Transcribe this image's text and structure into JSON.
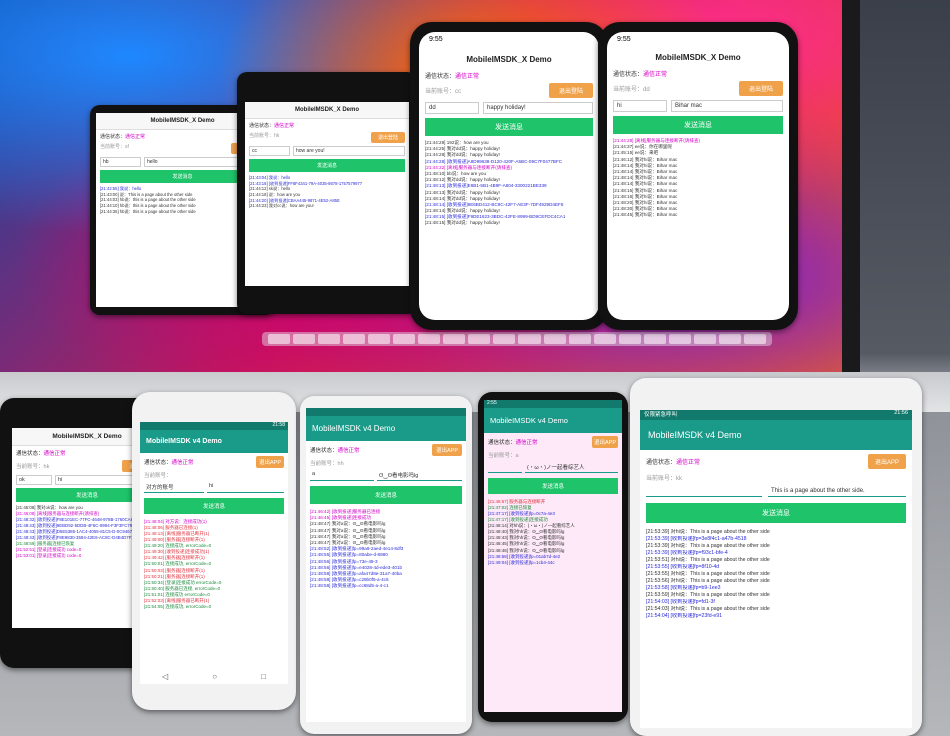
{
  "app": {
    "title_x": "MobileIMSDK_X Demo",
    "title_v4": "MobileIMSDK v4 Demo"
  },
  "labels": {
    "comm_status": "通信状态：",
    "status_ok": "通信正常",
    "current_account": "当前账号：",
    "logout": "退出登陆",
    "logout_app": "退出APP",
    "send": "发送消息",
    "placeholder_id": "对方的账号"
  },
  "laptop": {
    "phones": [
      {
        "account": "sf",
        "to": "hb",
        "msg": "hello",
        "logs": [
          "[21:42:55] 我说：hello",
          "[21:43:00] 说：This is a page about the other side",
          "[21:44:03] hb说：this is a page about the other side",
          "[21:44:10] hb说：this is a page about the other side",
          "[21:44:35] hb说：this is a page about the other side"
        ]
      },
      {
        "account": "hk",
        "to": "cc",
        "msg": "how are you!",
        "logs": [
          "[21:43:04] 我说：hello",
          "[21:43:18] [收到投递]FF8F4341-79A-4035-8678-1757579977",
          "[21:44:12] sk说：hello",
          "[21:44:18] 说：how are you",
          "[21:44:20] [收到投递]CBAA445-9871-4E52-A85E",
          "[21:44:23] 我对cc说：how are you!"
        ]
      },
      {
        "account": "cc",
        "to": "dd",
        "msg": "happy holiday!",
        "logs": [
          "[21:44:28] 192说：how are you",
          "[21:44:25] 我对dd说：happy holiday!",
          "[21:44:28] 我对dd说：happy holiday!",
          "[21:44:28] [收到投递]A8D99638-D120-420F-A5BC-09C7F0477BFC",
          "[21:44:32] [离线]服务器与连接断开(请排查)",
          "[21:48:10] bb说：how are you",
          "[21:48:12] 我对dd说：happy holiday!",
          "[21:48:13] [收到投递]E6B1-5B1-4B9F-A804-3300221BE339",
          "[21:48:13] 我对dd说：happy holiday!",
          "[21:48:14] 我对dd说：happy holiday!",
          "[21:48:14] [收到投递]9E6BD412-BC9C-42F7-AE3F-7DF4929D4EF6",
          "[21:48:14] 我对dd说：happy holiday!",
          "[21:48:15] [收到投递]F9DE1623-3BDC-42FE-8999-BD9CEFDC4CA1",
          "[21:48:15] 我对dd说：happy holiday!"
        ]
      },
      {
        "account": "dd",
        "to": "hi",
        "msg": "Bihar mac",
        "logs": [
          "[21:44:28] [离线]服务器与连接断开(请排查)",
          "[21:44:37] ee说：你在哪里呢",
          "[21:45:15] ee说：来吧",
          "[21:46:12] 我对hi说：Bihar mac",
          "[21:48:14] 我对hi说：Bihar mac",
          "[21:48:14] 我对hi说：Bihar mac",
          "[21:48:14] 我对hi说：Bihar mac",
          "[21:48:14] 我对hi说：Bihar mac",
          "[21:48:15] 我对hi说：Bihar mac",
          "[21:48:16] 我对hi说：Bihar mac",
          "[21:48:20] 我对hi说：Bihar mac",
          "[21:48:30] 我对hi说：Bihar mac",
          "[21:48:45] 我对hi说：Bihar mac"
        ]
      }
    ]
  },
  "desk": {
    "phones": [
      {
        "account": "hk",
        "to": "ok",
        "msg": "hi",
        "logs": [
          "[21:45:08] 我对ok说：how are you",
          "[21:46:08] [离线]服务器与连接断开(请排查)",
          "[21:48:32] [收到投递]F8E101EC-77FC-4648-978B-1760CA6D9D4",
          "[21:48:43] [收到投递]9EBD92-5DDB-4F6C-8994-F3F3FC793B77",
          "[21:48:43] [收到投递]D5E5386-1AC4-4055-81C5-D-0C94678A869",
          "[21:48:43] [收到投递]F8E9830-3594-42E6-AC8C-D4B4D7F39869",
          "[21:48:59] [服务器]连接已恢复",
          "[21:52:51] [登录]连接成功 code=0",
          "[21:53:01] [登录]连接成功 code=0"
        ]
      },
      {
        "account": "",
        "to": "",
        "msg": "hi",
        "logs": [
          "[21:48:04] 对方说：连接成功(1)",
          "[21:48:06] 服务器已连接(1)",
          "[21:48:13] [离线]服务器已断开(1)",
          "[21:49:00] [服务器]连接断开(1)",
          "[21:49:20] 连接成功, errorCode=0",
          "[21:49:30] [收到投递]连接成功(1)",
          "[21:49:42] [服务器]连接断开(1)",
          "[21:50:01] 连接成功, errorCode=0",
          "[21:50:03] [服务器]连接断开(1)",
          "[21:50:21] [服务器]连接断开(1)",
          "[21:50:34] [登录]连接成功 errorCode=0",
          "[21:50:40] 服务器已连接, errorCode=0",
          "[21:51:01] 连接成功 errorCode=0",
          "[21:52:03] [离线]服务器已断开(1)",
          "[21:54:05] 连接成功, errorCode=0"
        ]
      },
      {
        "account": "hh",
        "to": "a",
        "msg": "ʘ‿ʘ看电影吗lg",
        "logs": [
          "[21:46:42] [收到投递]服务器已连接",
          "[21:46:45] [收到投递]连接成功",
          "[21:48:47] 我对a说：ʘ‿ʘ看电影吗lg",
          "[21:48:47] 我对a说：ʘ‿ʘ看电影吗lg",
          "[21:48:47] 我对a说：ʘ‿ʘ看电影吗lg",
          "[21:48:47] 我对a说：ʘ‿ʘ看电影吗lg",
          "[21:48:52] [收到投递]fp=99a9-2aed-4e14-8df3",
          "[21:48:55] [收到投递]fp=80abe-d-8980",
          "[21:48:56] [收到投递]fp=73e-49-3",
          "[21:48:56] [收到投递]fp=e4028-4d-ede3-401b",
          "[21:48:58] [收到投递]fp=afa47d8e-31a7-40ba",
          "[21:48:58] [收到投递]fp=c29b0f5-a-4c6",
          "[21:48:58] [收到投递]fp=cc68d5-a-4-c1"
        ]
      },
      {
        "account": "a",
        "to": "",
        "msg": "(・ω・)ノ一起看综艺人",
        "logs": [
          "[21:46:57] 服务器与连接断开",
          "[21:47:02] 连接已恢复",
          "[21:47:17] [收到投递]fp=0c7a-4e3",
          "[21:47:17] [收到投递]连接成功",
          "[21:48:14] 对hh说：(・ω・)ノ一起看综艺人",
          "[21:48:40] 我对hh说：ʘ‿ʘ看电影吗lg",
          "[21:48:43] 我对hh说：ʘ‿ʘ看电影吗lg",
          "[21:48:45] 我对hh说：ʘ‿ʘ看电影吗lg",
          "[21:48:46] 我对hh说：ʘ‿ʘ看电影吗lg",
          "[21:48:58] [收到投递]fp=01ab7d-4e2",
          "[21:49:04] [收到投递]fp=1cb4-44c"
        ]
      },
      {
        "account": "kk",
        "to": "",
        "msg": "This is a page about the other side.",
        "logs": [
          "[21:53:39] 对hi说：This is a page about the other side",
          "[21:53:39] [收到投递]fp=3e8f4c1-a47b-4518",
          "[21:53:39] 对hi说：This is a page about the other side",
          "[21:53:39] [收到投递]fp=f93c1-bfe-4",
          "[21:53:51] 对hi说：This is a page about the other side",
          "[21:53:55] [收到投递]fp=8f10-4d",
          "[21:53:55] 对hi说：This is a page about the other side",
          "[21:53:56] 对hi说：This is a page about the other side",
          "[21:53:58] [收到投递]fp=b9-1ee3",
          "[21:53:59] 对hi说：This is a page about the other side",
          "[21:54:03] [收到投递]fp=fd1-3f",
          "[21:54:03] 对hi说：This is a page about the other side",
          "[21:54:04] [收到投递]fp=23fd-e91"
        ]
      }
    ]
  }
}
